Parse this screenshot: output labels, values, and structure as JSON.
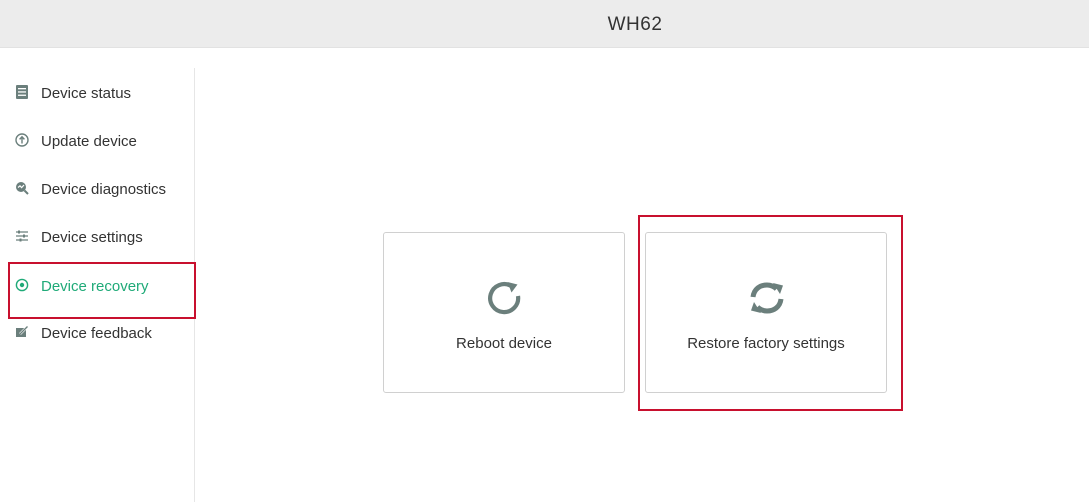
{
  "header": {
    "title": "WH62"
  },
  "sidebar": {
    "items": [
      {
        "label": "Device status",
        "icon": "list-icon"
      },
      {
        "label": "Update device",
        "icon": "upload-circle-icon"
      },
      {
        "label": "Device diagnostics",
        "icon": "diagnostics-icon"
      },
      {
        "label": "Device settings",
        "icon": "sliders-icon"
      },
      {
        "label": "Device recovery",
        "icon": "recovery-icon",
        "active": true
      },
      {
        "label": "Device feedback",
        "icon": "feedback-icon"
      }
    ]
  },
  "main": {
    "cards": [
      {
        "label": "Reboot device",
        "icon": "reboot-icon"
      },
      {
        "label": "Restore factory settings",
        "icon": "restore-icon"
      }
    ]
  },
  "colors": {
    "header_bg": "#ececec",
    "accent": "#1faa78",
    "highlight": "#c8102e",
    "icon_gray": "#6b7f7c"
  }
}
